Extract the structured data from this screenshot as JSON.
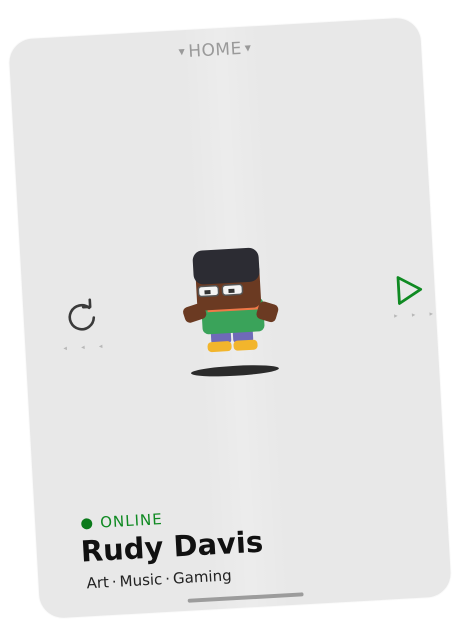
{
  "header": {
    "tab_label": "HOME"
  },
  "controls": {
    "reset_icon": "refresh-icon",
    "play_icon": "play-icon",
    "left_dots": "◂ ◂ ◂",
    "right_dots": "▸ ▸ ▸"
  },
  "profile": {
    "status": "ONLINE",
    "status_color": "#0a7a1a",
    "name": "Rudy Davis",
    "tags": [
      "Art",
      "Music",
      "Gaming"
    ]
  },
  "colors": {
    "card_bg": "#e8e8e8",
    "accent_green": "#0f8a22"
  }
}
